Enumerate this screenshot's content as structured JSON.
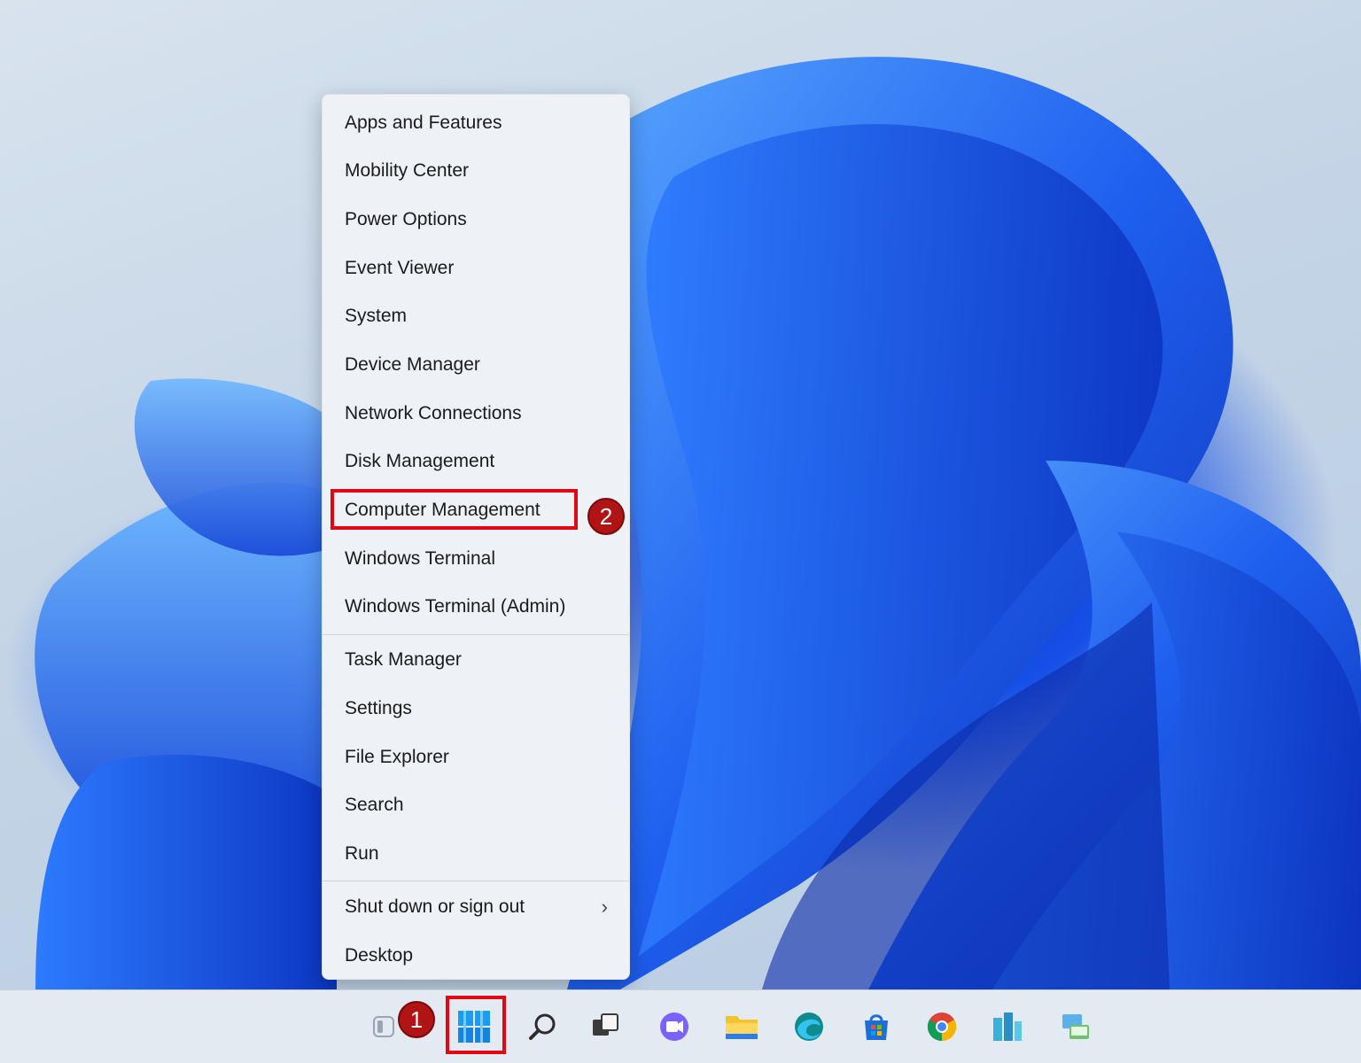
{
  "context_menu": {
    "items": [
      {
        "label": "Apps and Features"
      },
      {
        "label": "Mobility Center"
      },
      {
        "label": "Power Options"
      },
      {
        "label": "Event Viewer"
      },
      {
        "label": "System"
      },
      {
        "label": "Device Manager"
      },
      {
        "label": "Network Connections"
      },
      {
        "label": "Disk Management"
      },
      {
        "label": "Computer Management"
      },
      {
        "label": "Windows Terminal"
      },
      {
        "label": "Windows Terminal (Admin)"
      },
      {
        "label": "Task Manager"
      },
      {
        "label": "Settings"
      },
      {
        "label": "File Explorer"
      },
      {
        "label": "Search"
      },
      {
        "label": "Run"
      },
      {
        "label": "Shut down or sign out",
        "chevron": "›"
      },
      {
        "label": "Desktop"
      }
    ]
  },
  "annotations": {
    "step1": "1",
    "step2": "2",
    "highlight_color": "#e30613",
    "badge_color": "#b01414"
  },
  "taskbar": {
    "icons": [
      {
        "name": "widgets-icon"
      },
      {
        "name": "start-icon"
      },
      {
        "name": "search-icon"
      },
      {
        "name": "task-view-icon"
      },
      {
        "name": "chat-icon"
      },
      {
        "name": "file-explorer-icon"
      },
      {
        "name": "edge-icon"
      },
      {
        "name": "microsoft-store-icon"
      },
      {
        "name": "chrome-icon"
      },
      {
        "name": "app-icon"
      },
      {
        "name": "network-app-icon"
      }
    ]
  }
}
